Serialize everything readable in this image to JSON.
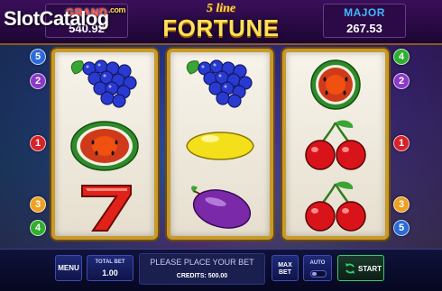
{
  "watermark": {
    "brand": "SlotCatalog",
    "suffix": ".com"
  },
  "jackpots": {
    "grand": {
      "label": "GRAND",
      "value": "540.92"
    },
    "major": {
      "label": "MAJOR",
      "value": "267.53"
    }
  },
  "logo": {
    "subtitle": "5 line",
    "title": "FORTUNE"
  },
  "reels": [
    [
      "grapes",
      "watermelon",
      "seven"
    ],
    [
      "grapes",
      "lemon",
      "plum"
    ],
    [
      "watermelon",
      "cherries",
      "cherries"
    ]
  ],
  "line_markers": {
    "left": [
      "5",
      "2",
      "1",
      "3",
      "4"
    ],
    "right": [
      "4",
      "2",
      "1",
      "3",
      "5"
    ]
  },
  "controls": {
    "menu_label": "MENU",
    "total_bet_label": "TOTAL BET",
    "total_bet_value": "1.00",
    "message": "PLEASE PLACE YOUR BET",
    "credits": "CREDITS: 500.00",
    "max_bet_line1": "MAX",
    "max_bet_line2": "BET",
    "auto_label": "AUTO",
    "start_label": "START"
  },
  "colors": {
    "line_blue": "#2b6bd8",
    "line_purple": "#8a3acb",
    "line_red": "#d8222a",
    "line_orange": "#f0a020",
    "line_green": "#2fae2f",
    "gold_frame": "#c99a2a"
  }
}
